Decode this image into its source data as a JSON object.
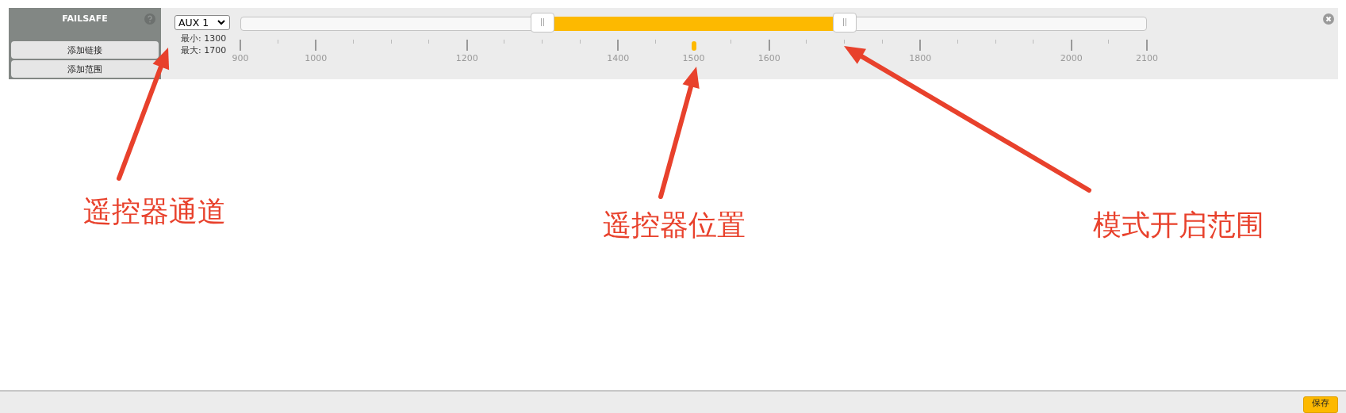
{
  "mode": {
    "name": "FAILSAFE",
    "buttons": [
      "添加链接",
      "添加范围"
    ],
    "channel": {
      "value": "AUX 1"
    },
    "min_label": "最小: 1300",
    "max_label": "最大: 1700",
    "handles": [
      {
        "level": 0.3333
      },
      {
        "level": 0.6667
      }
    ],
    "position": {
      "level": 0.5
    },
    "scale": [
      "900",
      "1000",
      "1200",
      "1400",
      "1500",
      "1600",
      "1800",
      "2000",
      "2100"
    ]
  },
  "annotations": [
    {
      "text": "遥控器通道"
    },
    {
      "text": "遥控器位置"
    },
    {
      "text": "模式开启范围"
    }
  ],
  "footer": {
    "save_button": "保存"
  }
}
